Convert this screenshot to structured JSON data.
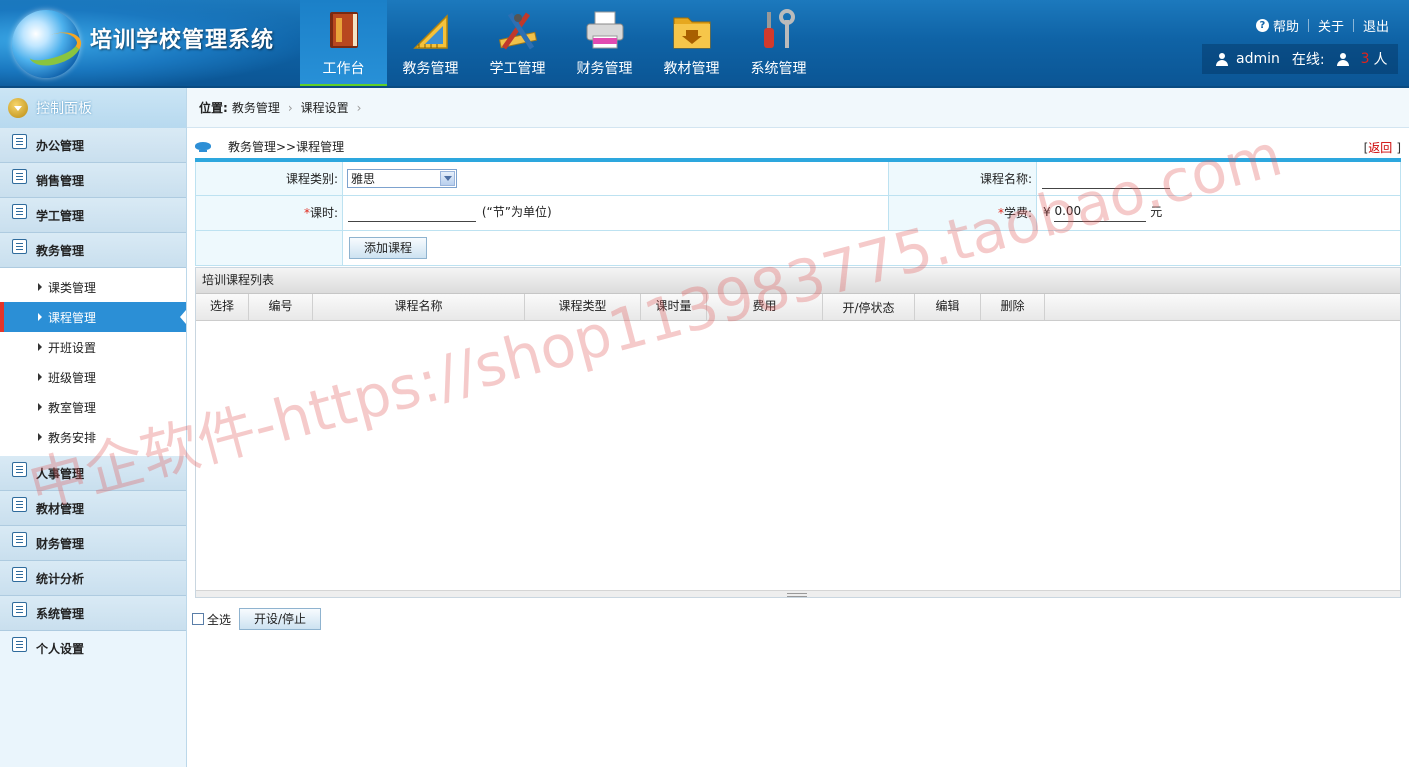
{
  "app": {
    "title": "培训学校管理系统"
  },
  "nav": {
    "items": [
      {
        "label": "工作台",
        "icon": "book-icon",
        "active": true
      },
      {
        "label": "教务管理",
        "icon": "ruler-icon"
      },
      {
        "label": "学工管理",
        "icon": "tools-pencil-icon"
      },
      {
        "label": "财务管理",
        "icon": "printer-icon"
      },
      {
        "label": "教材管理",
        "icon": "folder-download-icon"
      },
      {
        "label": "系统管理",
        "icon": "wrench-screwdriver-icon"
      }
    ]
  },
  "top_links": {
    "help": "帮助",
    "about": "关于",
    "logout": "退出"
  },
  "user": {
    "name": "admin",
    "online_label": "在线:",
    "online_count": "3",
    "online_unit": "人"
  },
  "sidebar": {
    "panel_title": "控制面板",
    "groups": [
      {
        "label": "办公管理"
      },
      {
        "label": "销售管理"
      },
      {
        "label": "学工管理"
      },
      {
        "label": "教务管理",
        "expanded": true
      }
    ],
    "sub_items": [
      {
        "label": "课类管理"
      },
      {
        "label": "课程管理",
        "active": true
      },
      {
        "label": "开班设置"
      },
      {
        "label": "班级管理"
      },
      {
        "label": "教室管理"
      },
      {
        "label": "教务安排"
      }
    ],
    "groups_after": [
      {
        "label": "人事管理"
      },
      {
        "label": "教材管理"
      },
      {
        "label": "财务管理"
      },
      {
        "label": "统计分析"
      },
      {
        "label": "系统管理"
      },
      {
        "label": "个人设置"
      }
    ]
  },
  "breadcrumb": {
    "label": "位置:",
    "items": [
      "教务管理",
      "课程设置"
    ]
  },
  "form": {
    "title": "教务管理>>课程管理",
    "back": {
      "open": "[",
      "label": "返回",
      "close": "]"
    },
    "category_label": "课程类别:",
    "category_value": "雅思",
    "name_label": "课程名称:",
    "name_value": "",
    "hours_required": "*",
    "hours_label": "课时:",
    "hours_value": "",
    "hours_hint": "(“节”为单位)",
    "fee_required": "*",
    "fee_label": "学费:",
    "fee_currency": "¥",
    "fee_value": "0.00",
    "fee_unit": "元",
    "add_button": "添加课程"
  },
  "grid": {
    "title": "培训课程列表",
    "columns": [
      "选择",
      "编号",
      "课程名称",
      "课程类型",
      "课时量",
      "费用",
      "开/停状态",
      "编辑",
      "删除"
    ],
    "rows": []
  },
  "footer": {
    "select_all": "全选",
    "toggle_button": "开设/停止"
  },
  "watermark": "中企软件-https://shop113983775.taobao.com",
  "colors": {
    "header": "#0f63a6",
    "accent": "#2da7de",
    "active_menu": "#2b8fd6",
    "nav_active_bar": "#5fcf26"
  }
}
